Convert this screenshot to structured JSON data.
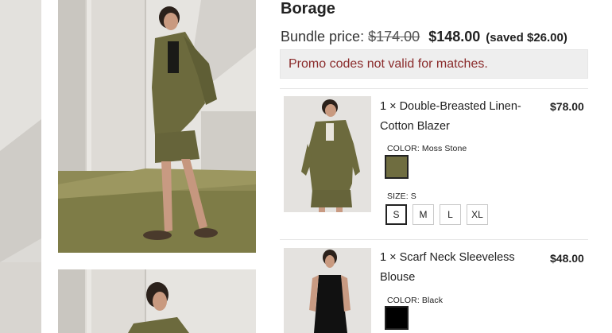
{
  "product": {
    "title": "Borage",
    "bundle_label": "Bundle price:",
    "old_price": "$174.00",
    "new_price": "$148.00",
    "saved_text": "(saved $26.00)"
  },
  "promo": {
    "message": "Promo codes not valid for matches."
  },
  "items": [
    {
      "name": "1 × Double-Breasted Linen-Cotton Blazer",
      "price": "$78.00",
      "color_label": "COLOR: Moss Stone",
      "color_hex": "#6f6d40",
      "size_label": "SIZE: S",
      "sizes": [
        "S",
        "M",
        "L",
        "XL"
      ],
      "selected_size": "S"
    },
    {
      "name": "1 × Scarf Neck Sleeveless Blouse",
      "price": "$48.00",
      "color_label": "COLOR: Black",
      "color_hex": "#000000"
    }
  ],
  "colors": {
    "promo_text": "#8a2b2b",
    "promo_bg": "#eeeeee",
    "moss_stone": "#6f6d40",
    "black": "#000000"
  }
}
